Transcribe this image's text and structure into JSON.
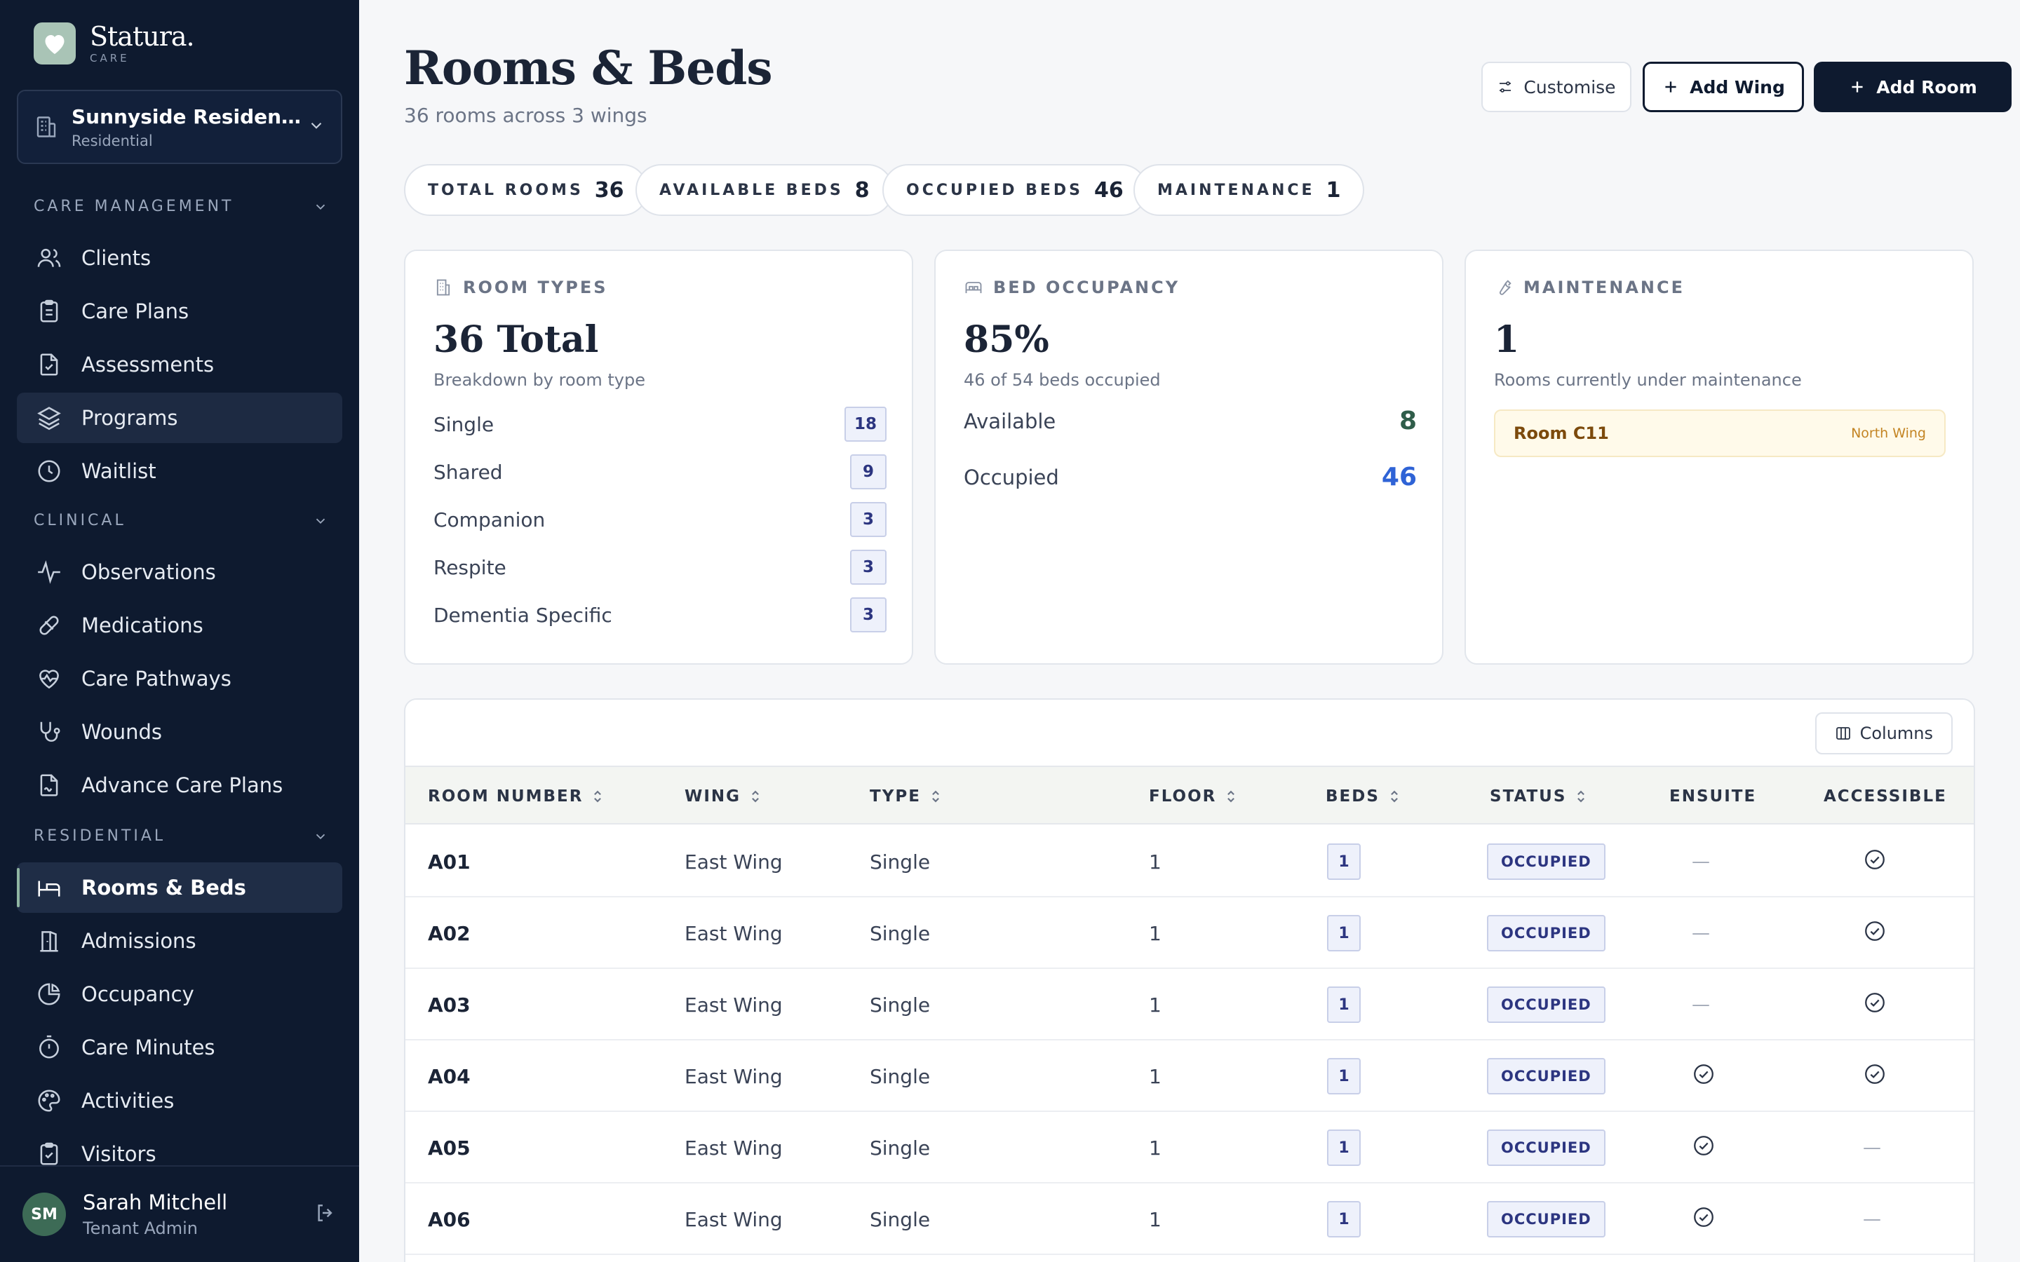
{
  "brand": {
    "name": "Statura.",
    "sub": "CARE"
  },
  "org": {
    "name": "Sunnyside Residential Care",
    "type": "Residential"
  },
  "nav": {
    "sections": [
      {
        "label": "CARE MANAGEMENT"
      },
      {
        "label": "CLINICAL"
      },
      {
        "label": "RESIDENTIAL"
      }
    ],
    "items": [
      {
        "label": "Clients",
        "icon": "users-icon"
      },
      {
        "label": "Care Plans",
        "icon": "clipboard-icon"
      },
      {
        "label": "Assessments",
        "icon": "file-check-icon"
      },
      {
        "label": "Programs",
        "icon": "layers-icon"
      },
      {
        "label": "Waitlist",
        "icon": "clock-icon"
      },
      {
        "label": "Observations",
        "icon": "activity-icon"
      },
      {
        "label": "Medications",
        "icon": "pill-icon"
      },
      {
        "label": "Care Pathways",
        "icon": "heart-pulse-icon"
      },
      {
        "label": "Wounds",
        "icon": "stethoscope-icon"
      },
      {
        "label": "Advance Care Plans",
        "icon": "file-signature-icon"
      },
      {
        "label": "Rooms & Beds",
        "icon": "bed-icon"
      },
      {
        "label": "Admissions",
        "icon": "door-icon"
      },
      {
        "label": "Occupancy",
        "icon": "pie-chart-icon"
      },
      {
        "label": "Care Minutes",
        "icon": "timer-icon"
      },
      {
        "label": "Activities",
        "icon": "palette-icon"
      },
      {
        "label": "Visitors",
        "icon": "clipboard-list-icon"
      }
    ]
  },
  "user": {
    "initials": "SM",
    "name": "Sarah Mitchell",
    "role": "Tenant Admin"
  },
  "page": {
    "title": "Rooms & Beds",
    "subtitle": "36 rooms across 3 wings"
  },
  "actions": {
    "customise": "Customise",
    "add_wing": "Add Wing",
    "add_room": "Add Room"
  },
  "stats": [
    {
      "label": "TOTAL ROOMS",
      "value": "36"
    },
    {
      "label": "AVAILABLE BEDS",
      "value": "8"
    },
    {
      "label": "OCCUPIED BEDS",
      "value": "46"
    },
    {
      "label": "MAINTENANCE",
      "value": "1"
    }
  ],
  "room_types": {
    "title": "ROOM TYPES",
    "big": "36 Total",
    "desc": "Breakdown by room type",
    "rows": [
      {
        "label": "Single",
        "count": "18"
      },
      {
        "label": "Shared",
        "count": "9"
      },
      {
        "label": "Companion",
        "count": "3"
      },
      {
        "label": "Respite",
        "count": "3"
      },
      {
        "label": "Dementia Specific",
        "count": "3"
      }
    ]
  },
  "bed_occupancy": {
    "title": "BED OCCUPANCY",
    "big": "85%",
    "desc": "46 of 54 beds occupied",
    "available_label": "Available",
    "available_value": "8",
    "available_color": "#2f5d4a",
    "occupied_label": "Occupied",
    "occupied_value": "46",
    "occupied_color": "#2f63d6"
  },
  "maintenance": {
    "title": "MAINTENANCE",
    "big": "1",
    "desc": "Rooms currently under maintenance",
    "room": "Room C11",
    "wing": "North Wing"
  },
  "table": {
    "columns_button": "Columns",
    "headers": [
      "ROOM NUMBER",
      "WING",
      "TYPE",
      "FLOOR",
      "BEDS",
      "STATUS",
      "ENSUITE",
      "ACCESSIBLE"
    ],
    "rows": [
      {
        "room": "A01",
        "wing": "East Wing",
        "type": "Single",
        "floor": "1",
        "beds": "1",
        "status": "OCCUPIED",
        "ensuite": false,
        "accessible": true
      },
      {
        "room": "A02",
        "wing": "East Wing",
        "type": "Single",
        "floor": "1",
        "beds": "1",
        "status": "OCCUPIED",
        "ensuite": false,
        "accessible": true
      },
      {
        "room": "A03",
        "wing": "East Wing",
        "type": "Single",
        "floor": "1",
        "beds": "1",
        "status": "OCCUPIED",
        "ensuite": false,
        "accessible": true
      },
      {
        "room": "A04",
        "wing": "East Wing",
        "type": "Single",
        "floor": "1",
        "beds": "1",
        "status": "OCCUPIED",
        "ensuite": true,
        "accessible": true
      },
      {
        "room": "A05",
        "wing": "East Wing",
        "type": "Single",
        "floor": "1",
        "beds": "1",
        "status": "OCCUPIED",
        "ensuite": true,
        "accessible": false
      },
      {
        "room": "A06",
        "wing": "East Wing",
        "type": "Single",
        "floor": "1",
        "beds": "1",
        "status": "OCCUPIED",
        "ensuite": true,
        "accessible": false
      }
    ]
  },
  "colors": {
    "sidebar": "#0e1a2f",
    "primary": "#0e1a2f",
    "accent_green": "#8fb5a2",
    "badge_blue": "#2c3580"
  }
}
